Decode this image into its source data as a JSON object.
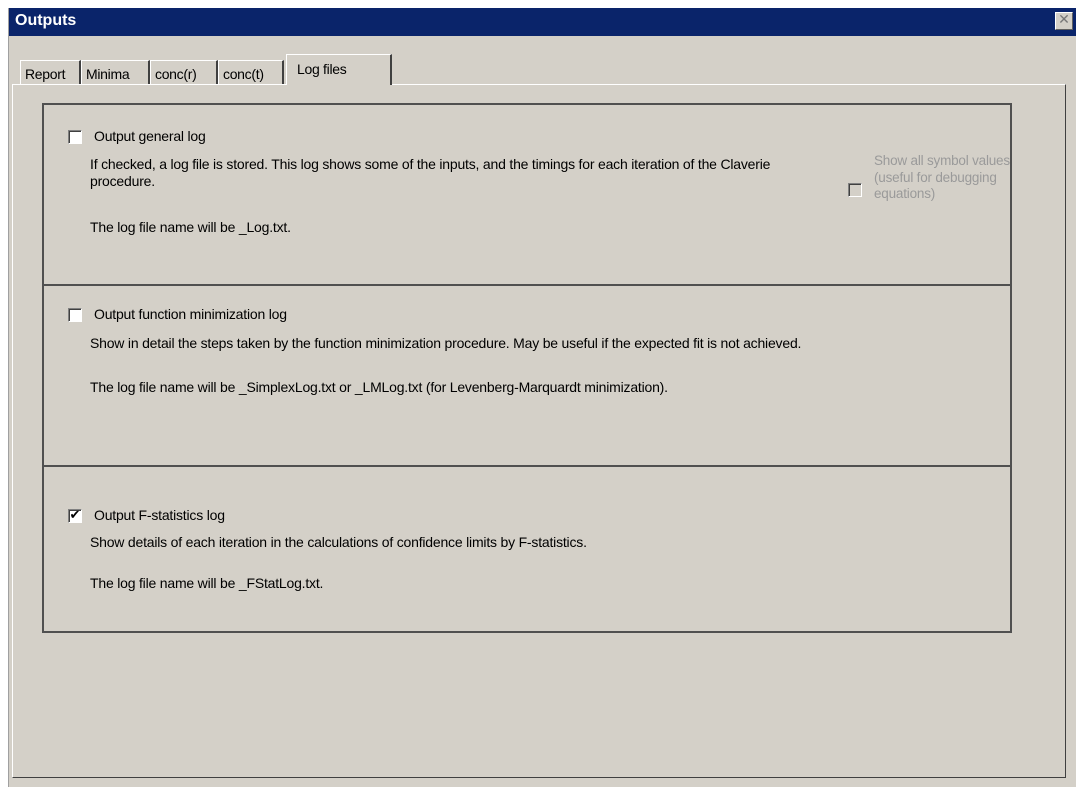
{
  "window": {
    "title": "Outputs",
    "close_glyph": "✕"
  },
  "tabs": [
    {
      "label": "Report",
      "active": false
    },
    {
      "label": "Minima",
      "active": false
    },
    {
      "label": "conc(r)",
      "active": false
    },
    {
      "label": "conc(t)",
      "active": false
    },
    {
      "label": "Log files",
      "active": true
    }
  ],
  "general_log": {
    "checkbox_label": "Output general log",
    "checked": false,
    "description": "If checked, a log file is stored. This log shows some of the inputs, and the timings for each iteration of the Claverie procedure.",
    "filename_note": "The log file name will be _Log.txt.",
    "symbol_option": {
      "label": "Show all symbol values (useful for debugging equations)",
      "checked": false,
      "enabled": false
    }
  },
  "minimization_log": {
    "checkbox_label": "Output function minimization log",
    "checked": false,
    "description": "Show in detail the steps taken by the function minimization procedure. May be useful if the expected fit is not achieved.",
    "filename_note": "The log file name will be _SimplexLog.txt or _LMLog.txt (for Levenberg-Marquardt minimization)."
  },
  "fstat_log": {
    "checkbox_label": "Output F-statistics log",
    "checked": true,
    "check_glyph": "✔",
    "description": "Show details of each iteration in the calculations of confidence limits by F-statistics.",
    "filename_note": "The log file name will be _FStatLog.txt."
  }
}
